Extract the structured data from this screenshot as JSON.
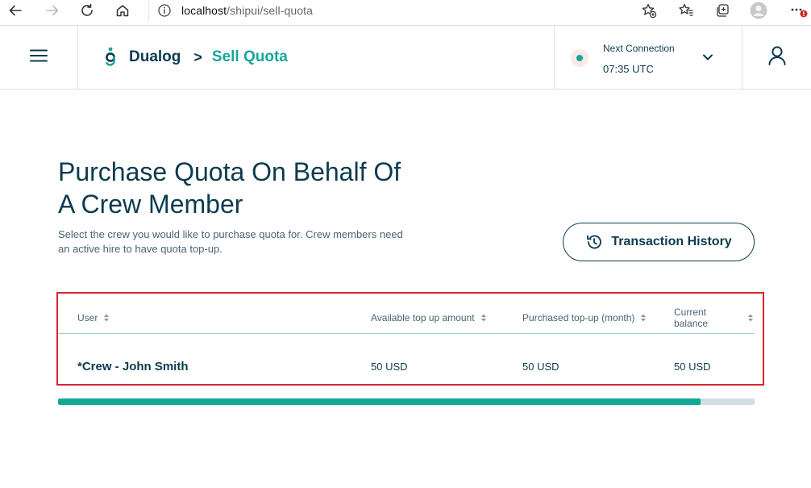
{
  "browser": {
    "url_host": "localhost",
    "url_path": "/shipui/sell-quota"
  },
  "header": {
    "brand": "Dualog",
    "breadcrumb_separator": ">",
    "breadcrumb_current": "Sell Quota",
    "connection": {
      "label": "Next Connection",
      "time": "07:35 UTC"
    }
  },
  "main": {
    "title": "Purchase Quota On Behalf Of A Crew Member",
    "description": "Select the crew you would like to purchase quota for. Crew members need an active hire to have quota top-up.",
    "history_button": "Transaction History"
  },
  "table": {
    "columns": [
      "User",
      "Available top up amount",
      "Purchased top-up (month)",
      "Current balance"
    ],
    "rows": [
      [
        "*Crew - John Smith",
        "50 USD",
        "50 USD",
        "50 USD"
      ]
    ]
  },
  "progress": {
    "fraction": 0.922
  },
  "colors": {
    "accent": "#1aa59a",
    "primary_text": "#0d3b4f",
    "highlight_border": "#d9262c",
    "progress_fill": "#12a898",
    "progress_track": "#d2dfe2"
  },
  "icons": {
    "back": "back-arrow-icon",
    "forward": "forward-arrow-icon",
    "reload": "reload-icon",
    "home": "home-icon",
    "info": "info-icon",
    "favorite_add": "favorite-add-icon",
    "favorites": "favorites-icon",
    "collections": "collections-icon",
    "profile": "profile-avatar-icon",
    "more": "more-icon",
    "menu": "hamburger-menu-icon",
    "logo": "dualog-logo-icon",
    "chevron": "chevron-down-icon",
    "user": "user-icon",
    "history": "history-clock-icon",
    "sort": "sort-icon"
  }
}
